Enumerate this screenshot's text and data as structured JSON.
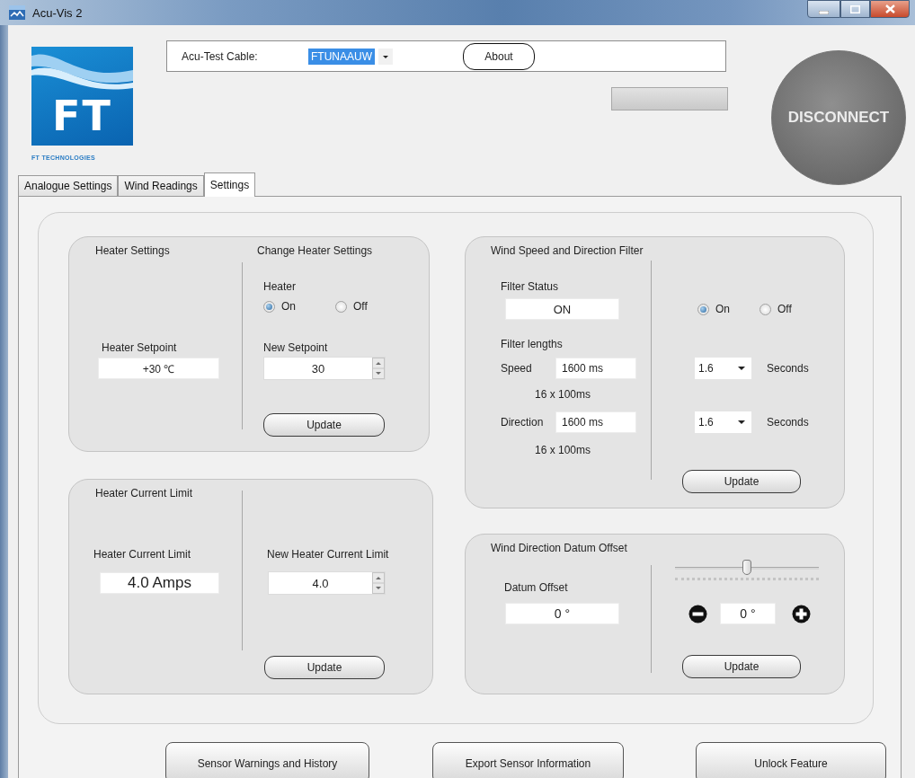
{
  "window": {
    "title": "Acu-Vis 2"
  },
  "logo": {
    "mark": "FT",
    "caption": "FT TECHNOLOGIES"
  },
  "cable": {
    "label": "Acu-Test Cable:",
    "value": "FTUNAAUW",
    "about_button": "About"
  },
  "disconnect_button": "DISCONNECT",
  "tabs": [
    {
      "label": "Analogue Settings",
      "selected": false
    },
    {
      "label": "Wind Readings",
      "selected": false
    },
    {
      "label": "Settings",
      "selected": true
    }
  ],
  "heater_settings": {
    "title": "Heater Settings",
    "setpoint_label": "Heater Setpoint",
    "setpoint_value": "+30 ℃"
  },
  "change_heater": {
    "title": "Change Heater Settings",
    "heater_label": "Heater",
    "options": [
      {
        "label": "On",
        "selected": true
      },
      {
        "label": "Off",
        "selected": false
      }
    ],
    "new_setpoint_label": "New Setpoint",
    "new_setpoint_value": "30",
    "update_button": "Update"
  },
  "heater_current": {
    "title": "Heater Current Limit",
    "current_label": "Heater Current Limit",
    "current_value": "4.0 Amps",
    "new_label": "New Heater Current Limit",
    "new_value": "4.0",
    "update_button": "Update"
  },
  "filter": {
    "title": "Wind Speed and Direction Filter",
    "status_label": "Filter Status",
    "status_value": "ON",
    "lengths_label": "Filter lengths",
    "options": [
      {
        "label": "On",
        "selected": true
      },
      {
        "label": "Off",
        "selected": false
      }
    ],
    "rows": [
      {
        "label": "Speed",
        "value": "1600 ms",
        "detail": "16 x 100ms",
        "select": "1.6",
        "unit": "Seconds"
      },
      {
        "label": "Direction",
        "value": "1600 ms",
        "detail": "16 x 100ms",
        "select": "1.6",
        "unit": "Seconds"
      }
    ],
    "update_button": "Update"
  },
  "datum": {
    "title": "Wind Direction Datum Offset",
    "offset_label": "Datum Offset",
    "offset_value": "0 °",
    "slider": {
      "level": 0.5
    },
    "step_value": "0 °",
    "update_button": "Update"
  },
  "footer_buttons": [
    "Sensor Warnings and History",
    "Export Sensor Information",
    "Unlock Feature"
  ]
}
